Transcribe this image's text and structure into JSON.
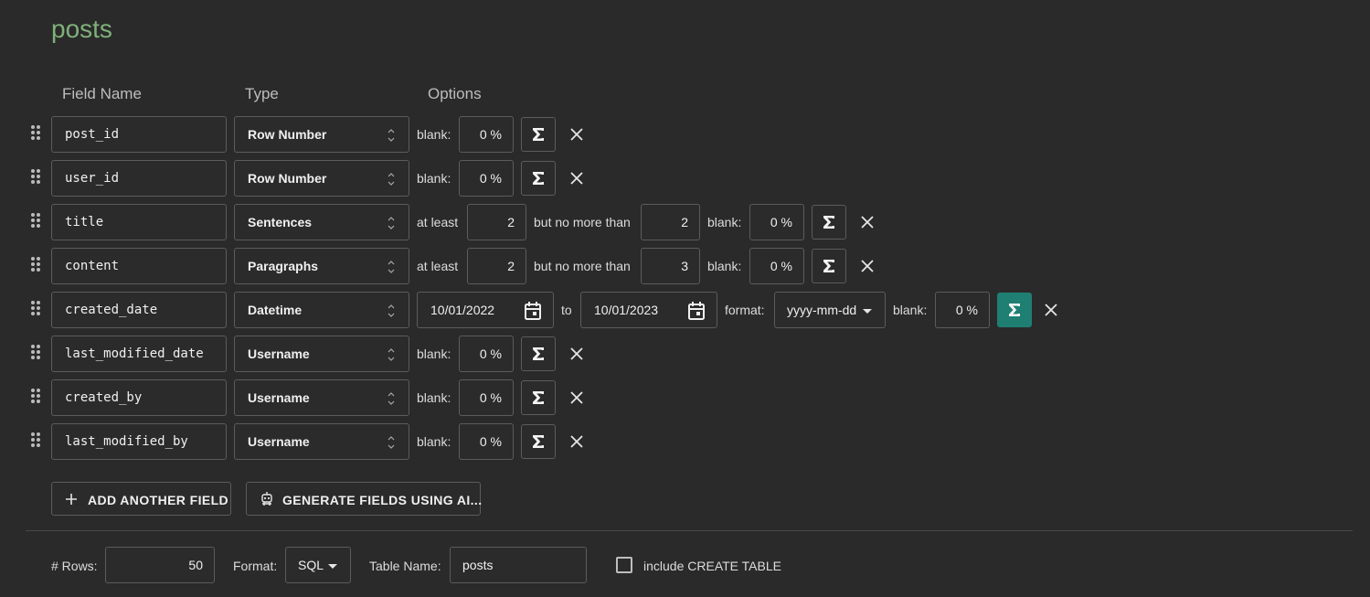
{
  "page": {
    "title": "posts"
  },
  "headers": {
    "field_name": "Field Name",
    "type": "Type",
    "options": "Options"
  },
  "labels": {
    "blank": "blank:",
    "at_least": "at least",
    "but_no_more_than": "but no more than",
    "to": "to",
    "format": "format:"
  },
  "fields": [
    {
      "name": "post_id",
      "type": "Row Number",
      "blank": "0 %"
    },
    {
      "name": "user_id",
      "type": "Row Number",
      "blank": "0 %"
    },
    {
      "name": "title",
      "type": "Sentences",
      "at_least": "2",
      "no_more_than": "2",
      "blank": "0 %"
    },
    {
      "name": "content",
      "type": "Paragraphs",
      "at_least": "2",
      "no_more_than": "3",
      "blank": "0 %"
    },
    {
      "name": "created_date",
      "type": "Datetime",
      "from": "10/01/2022",
      "to": "10/01/2023",
      "format": "yyyy-mm-dd",
      "blank": "0 %",
      "sigma_active": true
    },
    {
      "name": "last_modified_date",
      "type": "Username",
      "blank": "0 %"
    },
    {
      "name": "created_by",
      "type": "Username",
      "blank": "0 %"
    },
    {
      "name": "last_modified_by",
      "type": "Username",
      "blank": "0 %"
    }
  ],
  "actions": {
    "add_field": "ADD ANOTHER FIELD",
    "generate_ai": "GENERATE FIELDS USING AI..."
  },
  "footer": {
    "rows_label": "# Rows:",
    "rows_value": "50",
    "format_label": "Format:",
    "format_value": "SQL",
    "table_name_label": "Table Name:",
    "table_name_value": "posts",
    "create_table_label": "include CREATE TABLE",
    "create_table_checked": false
  },
  "colors": {
    "accent": "#1f7f73",
    "title": "#7fb07a",
    "background": "#2a2a2a"
  },
  "icons": [
    "drag-handle-icon",
    "updown-icon",
    "sigma-icon",
    "close-icon",
    "calendar-icon",
    "caret-down-icon",
    "plus-icon",
    "robot-icon"
  ]
}
